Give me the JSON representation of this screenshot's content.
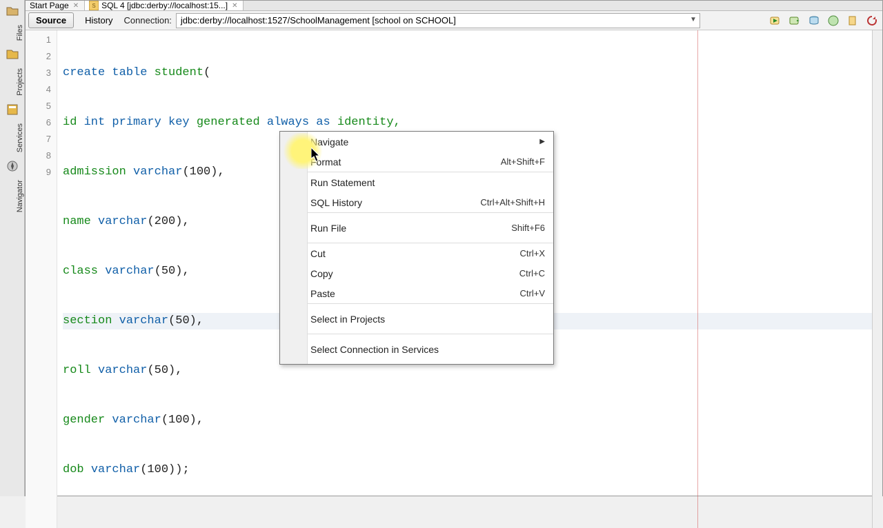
{
  "tabs": {
    "start": "Start Page",
    "sql": "SQL 4 [jdbc:derby://localhost:15...]"
  },
  "toolbar": {
    "source": "Source",
    "history": "History",
    "connection_label": "Connection:",
    "connection_value": "jdbc:derby://localhost:1527/SchoolManagement [school on SCHOOL]"
  },
  "sidebar": {
    "files": "Files",
    "projects": "Projects",
    "services": "Services",
    "navigator": "Navigator"
  },
  "code": {
    "l1_a": "create table ",
    "l1_b": "student",
    "l1_c": "(",
    "l2_a": "id ",
    "l2_b": "int primary key ",
    "l2_c": "generated ",
    "l2_d": "always as ",
    "l2_e": "identity,",
    "l3_a": "admission ",
    "l3_b": "varchar",
    "l3_c": "(100),",
    "l4_a": "name ",
    "l4_b": "varchar",
    "l4_c": "(200),",
    "l5_a": "class ",
    "l5_b": "varchar",
    "l5_c": "(50),",
    "l6_a": "section ",
    "l6_b": "varchar",
    "l6_c": "(50),",
    "l7_a": "roll ",
    "l7_b": "varchar",
    "l7_c": "(50),",
    "l8_a": "gender ",
    "l8_b": "varchar",
    "l8_c": "(100),",
    "l9_a": "dob ",
    "l9_b": "varchar",
    "l9_c": "(100));"
  },
  "lines": {
    "n1": "1",
    "n2": "2",
    "n3": "3",
    "n4": "4",
    "n5": "5",
    "n6": "6",
    "n7": "7",
    "n8": "8",
    "n9": "9"
  },
  "menu": {
    "navigate": "Navigate",
    "format": "Format",
    "format_sc": "Alt+Shift+F",
    "run_statement": "Run Statement",
    "sql_history": "SQL History",
    "sql_history_sc": "Ctrl+Alt+Shift+H",
    "run_file": "Run File",
    "run_file_sc": "Shift+F6",
    "cut": "Cut",
    "cut_sc": "Ctrl+X",
    "copy": "Copy",
    "copy_sc": "Ctrl+C",
    "paste": "Paste",
    "paste_sc": "Ctrl+V",
    "select_projects": "Select in Projects",
    "select_connection": "Select Connection in Services"
  }
}
